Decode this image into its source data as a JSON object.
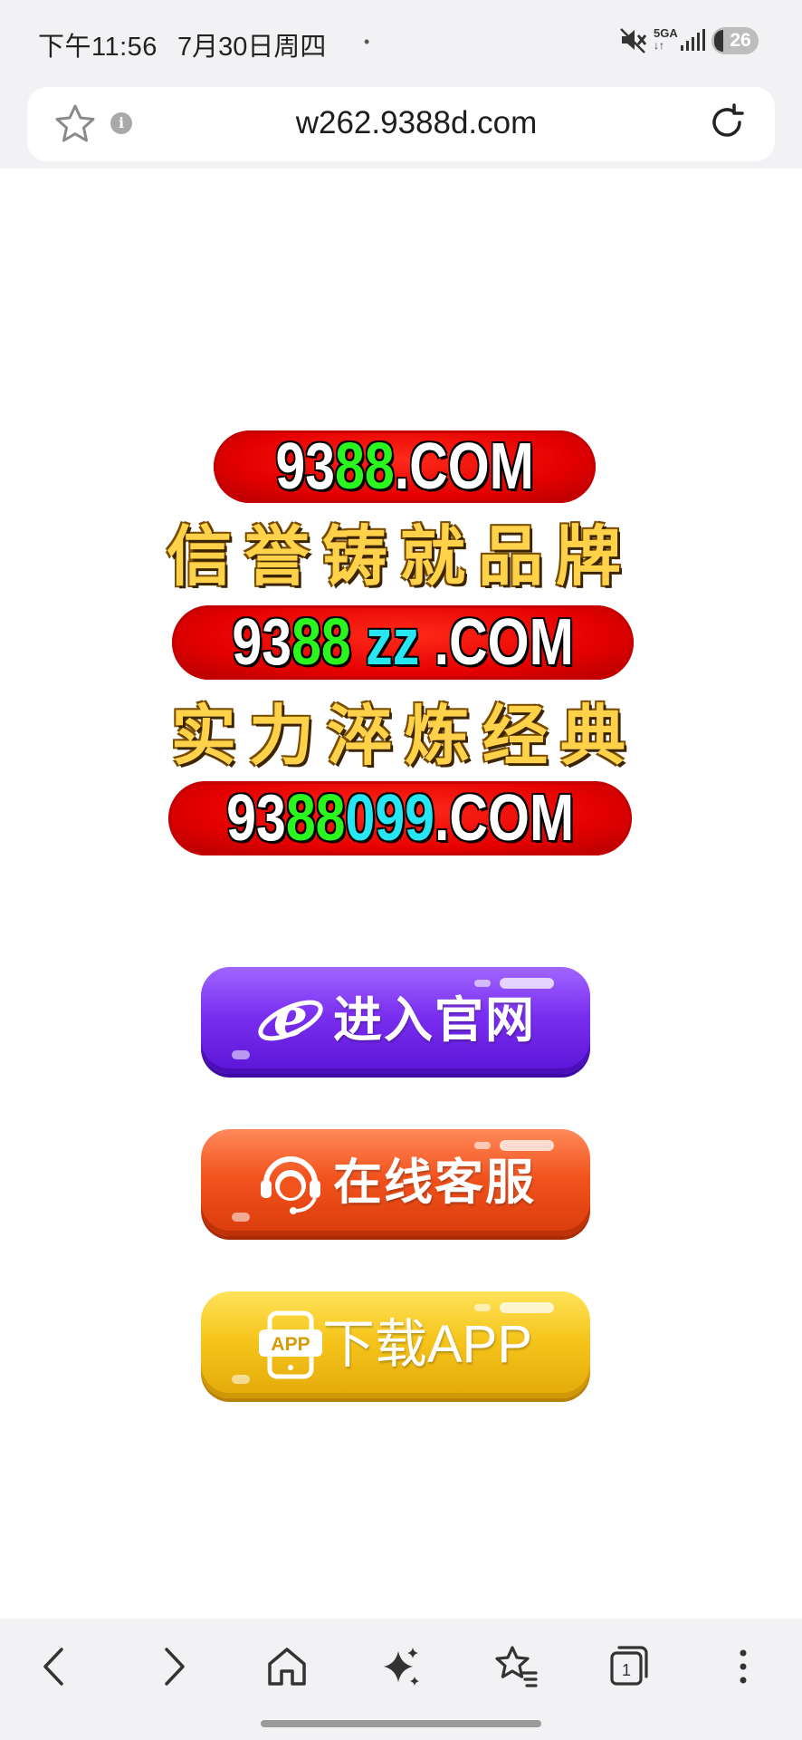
{
  "status_bar": {
    "time": "下午11:56",
    "date": "7月30日周四",
    "dot": "•",
    "network": "5GA",
    "battery": "26",
    "icons": [
      "mute-icon",
      "signal-icon",
      "battery-icon"
    ]
  },
  "browser": {
    "url": "w262.9388d.com",
    "icons": [
      "bookmark-star-icon",
      "site-info-icon",
      "reload-icon"
    ],
    "info_glyph": "i"
  },
  "banner": {
    "domain_1": {
      "white": "93",
      "green": "88",
      "rest": ".COM"
    },
    "slogan_1": "信誉铸就品牌",
    "domain_2": {
      "white": "93",
      "green": "88",
      "cyan": "zz",
      "rest": ".COM"
    },
    "slogan_2": "实力淬炼经典",
    "domain_3": {
      "white": "93",
      "green": "88",
      "cyan": "099",
      "rest": ".COM"
    }
  },
  "buttons": {
    "web": {
      "label": "进入官网",
      "icon": "ie-browser-icon",
      "color": "#7a2ff0"
    },
    "service": {
      "label": "在线客服",
      "icon": "headset-agent-icon",
      "color": "#f2531d"
    },
    "app": {
      "label": "下载APP",
      "icon": "phone-app-icon",
      "icon_text": "APP",
      "color": "#f6c51c"
    }
  },
  "bottom_nav": [
    "back-icon",
    "forward-icon",
    "home-icon",
    "ai-sparkle-icon",
    "bookmarks-icon",
    "tabs-icon",
    "menu-icon"
  ],
  "tab_count": "1"
}
